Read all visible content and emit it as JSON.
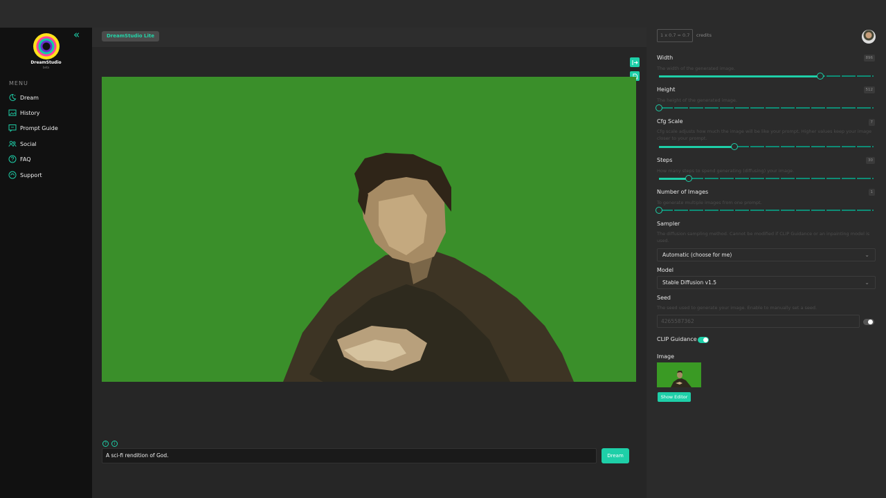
{
  "sidebar": {
    "brand": "DreamStudio",
    "brand_sub": "beta",
    "menu_label": "MENU",
    "items": [
      {
        "label": "Dream",
        "icon": "dream-moon-icon"
      },
      {
        "label": "History",
        "icon": "history-image-icon"
      },
      {
        "label": "Prompt Guide",
        "icon": "prompt-guide-icon"
      },
      {
        "label": "Social",
        "icon": "social-users-icon"
      },
      {
        "label": "FAQ",
        "icon": "faq-question-icon"
      },
      {
        "label": "Support",
        "icon": "support-icon"
      }
    ]
  },
  "header": {
    "badge": "DreamStudio Lite"
  },
  "credits": {
    "value": "1 x 0.7 = 0.7",
    "label": "credits"
  },
  "prompt": {
    "text": "A sci-fi rendition of God.",
    "dream_button": "Dream"
  },
  "settings": {
    "width": {
      "label": "Width",
      "desc": "The width of the generated image.",
      "value": "896",
      "fraction": 0.75
    },
    "height": {
      "label": "Height",
      "desc": "The height of the generated image.",
      "value": "512",
      "fraction": 0.0
    },
    "cfg": {
      "label": "Cfg Scale",
      "desc": "Cfg scale adjusts how much the image will be like your prompt. Higher values keep your image closer to your prompt.",
      "value": "7",
      "fraction": 0.35
    },
    "steps": {
      "label": "Steps",
      "desc": "How many steps to spend generating (diffusing) your image.",
      "value": "30",
      "fraction": 0.14
    },
    "num_images": {
      "label": "Number of Images",
      "desc": "To generate multiple images from one prompt.",
      "value": "1",
      "fraction": 0.0
    },
    "sampler": {
      "label": "Sampler",
      "desc": "The diffusion sampling method. Cannot be modified if CLIP Guidance or an inpainting model is used.",
      "value": "Automatic (choose for me)"
    },
    "model": {
      "label": "Model",
      "value": "Stable Diffusion v1.5"
    },
    "seed": {
      "label": "Seed",
      "desc": "The seed used to generate your image. Enable to manually set a seed.",
      "placeholder": "4265587362",
      "enabled": false
    },
    "clip": {
      "label": "CLIP Guidance",
      "enabled": true
    },
    "image": {
      "label": "Image",
      "button": "Show Editor"
    }
  },
  "colors": {
    "accent": "#1ecfa8",
    "canvas_green": "#3a8f2a"
  }
}
